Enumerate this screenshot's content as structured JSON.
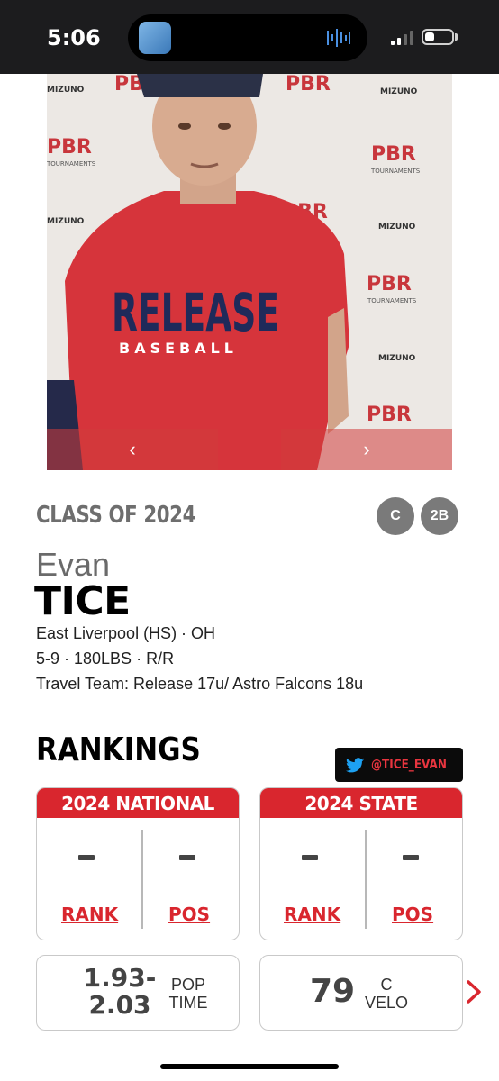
{
  "status_bar": {
    "time": "5:06",
    "icons": [
      "app-thumbnail-icon",
      "audio-wave-icon",
      "cellular-signal-icon",
      "battery-icon"
    ]
  },
  "player_photo": {
    "shirt_text_line1": "RELEASE",
    "shirt_text_line2": "BASEBALL",
    "backdrop_logo": "PBR",
    "backdrop_logo_sub": "TOURNAMENTS",
    "backdrop_brand": "MIZUNO",
    "prev_icon": "‹",
    "next_icon": "›"
  },
  "player": {
    "class_label": "CLASS OF 2024",
    "positions": [
      "C",
      "2B"
    ],
    "first_name": "Evan",
    "last_name": "TICE",
    "school_line": "East Liverpool (HS) · OH",
    "physical_line": "5-9 · 180LBS · R/R",
    "travel_team_line": "Travel Team: Release 17u/ Astro Falcons 18u"
  },
  "rankings": {
    "title": "RANKINGS",
    "twitter_handle": "@TICE_EVAN",
    "colors": {
      "accent": "#d9262e",
      "twitter_blue": "#1da1f2"
    },
    "cards": [
      {
        "header": "2024 NATIONAL",
        "rank_label": "RANK",
        "pos_label": "POS"
      },
      {
        "header": "2024 STATE",
        "rank_label": "RANK",
        "pos_label": "POS"
      }
    ]
  },
  "stats": [
    {
      "value_line1": "1.93-",
      "value_line2": "2.03",
      "label_line1": "POP",
      "label_line2": "TIME"
    },
    {
      "value": "79",
      "label_line1": "C",
      "label_line2": "VELO"
    }
  ]
}
